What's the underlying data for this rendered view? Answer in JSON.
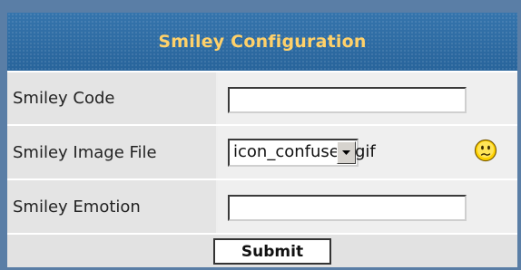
{
  "header": {
    "title": "Smiley Configuration"
  },
  "form": {
    "code": {
      "label": "Smiley Code",
      "value": "",
      "placeholder": ""
    },
    "image_file": {
      "label": "Smiley Image File",
      "selected": "icon_confused.gif",
      "preview_icon": "confused-smiley-icon"
    },
    "emotion": {
      "label": "Smiley Emotion",
      "value": "",
      "placeholder": ""
    }
  },
  "footer": {
    "submit_label": "Submit"
  },
  "colors": {
    "header_background": "#2f6aa0",
    "header_title": "#ffd16a",
    "border": "#5a7ea6",
    "row_background": "#eeeeee"
  }
}
